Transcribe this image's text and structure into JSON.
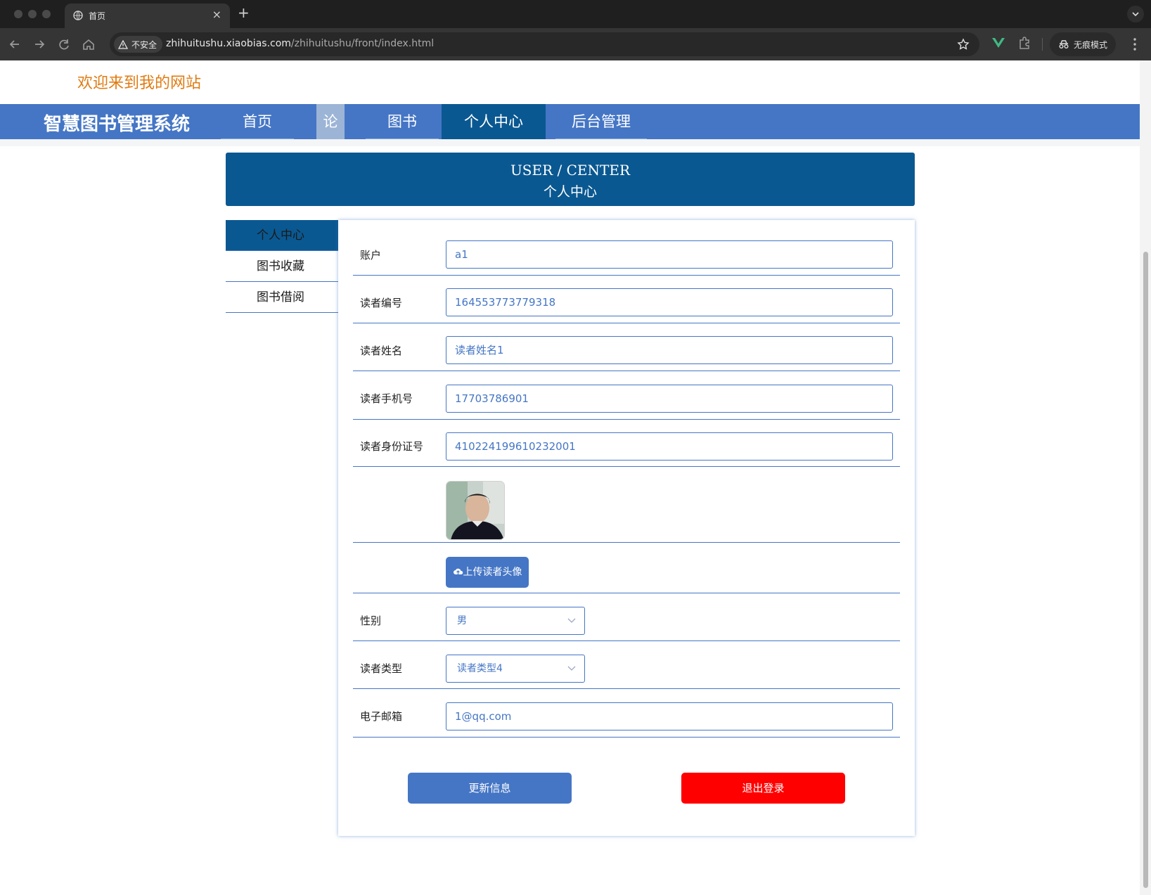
{
  "browser": {
    "tab_title": "首页",
    "security_label": "不安全",
    "url_host": "zhihuitushu.xiaobias.com",
    "url_path": "/zhihuitushu/front/index.html",
    "incognito_label": "无痕模式"
  },
  "site": {
    "welcome": "欢迎来到我的网站",
    "brand": "智慧图书管理系统",
    "nav": [
      "首页",
      "论坛",
      "图书",
      "个人中心",
      "后台管理"
    ]
  },
  "banner": {
    "en": "USER / CENTER",
    "zh": "个人中心"
  },
  "sidebar": {
    "items": [
      "个人中心",
      "图书收藏",
      "图书借阅"
    ]
  },
  "form": {
    "account": {
      "label": "账户",
      "value": "a1"
    },
    "reader_no": {
      "label": "读者编号",
      "value": "164553773779318"
    },
    "reader_name": {
      "label": "读者姓名",
      "value": "读者姓名1"
    },
    "reader_phone": {
      "label": "读者手机号",
      "value": "17703786901"
    },
    "reader_id": {
      "label": "读者身份证号",
      "value": "410224199610232001"
    },
    "upload_label": "上传读者头像",
    "gender": {
      "label": "性别",
      "value": "男"
    },
    "reader_type": {
      "label": "读者类型",
      "value": "读者类型4"
    },
    "email": {
      "label": "电子邮箱",
      "value": "1@qq.com"
    }
  },
  "actions": {
    "update": "更新信息",
    "logout": "退出登录"
  },
  "colors": {
    "nav_blue": "#4576c5",
    "dark_blue": "#0a5891",
    "welcome_orange": "#e07b12",
    "logout_red": "#ff0000"
  }
}
